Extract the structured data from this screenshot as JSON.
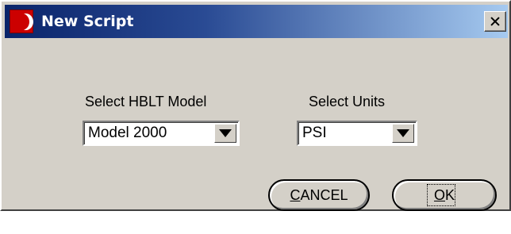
{
  "window": {
    "title": "New Script",
    "close_label": "×"
  },
  "model": {
    "label": "Select HBLT Model",
    "value": "Model 2000"
  },
  "units": {
    "label": "Select Units",
    "value": "PSI"
  },
  "buttons": {
    "cancel": "CANCEL",
    "ok": "OK"
  },
  "colors": {
    "titlebar_start": "#0a246a",
    "titlebar_end": "#a6caf0",
    "face": "#d4d0c8",
    "icon_red": "#cc0000"
  }
}
